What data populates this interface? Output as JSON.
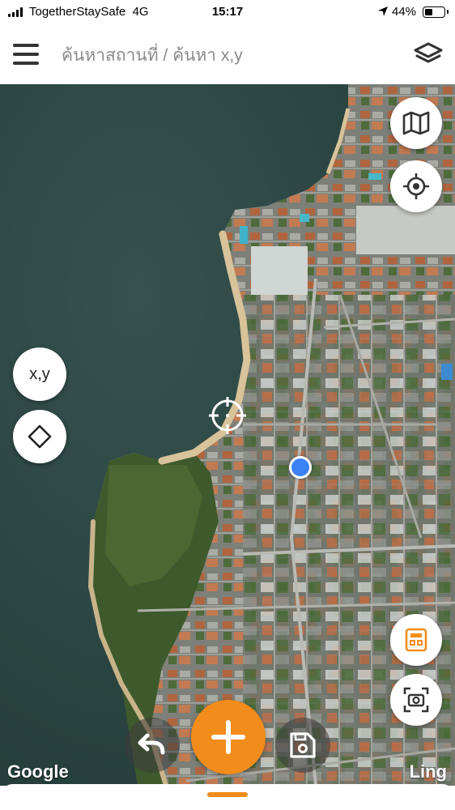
{
  "status_bar": {
    "carrier": "TogetherStaySafe",
    "network": "4G",
    "time": "15:17",
    "battery_percent": "44%",
    "battery_level": 0.44
  },
  "header": {
    "search_placeholder": "ค้นหาสถานที่ / ค้นหา x,y"
  },
  "map": {
    "type": "satellite",
    "attribution": "Google",
    "watermark": "Ling"
  },
  "controls": {
    "xy_label": "x,y"
  },
  "colors": {
    "accent": "#f28c1b",
    "location_dot": "#3b82f6",
    "sea": "#2b4744"
  }
}
